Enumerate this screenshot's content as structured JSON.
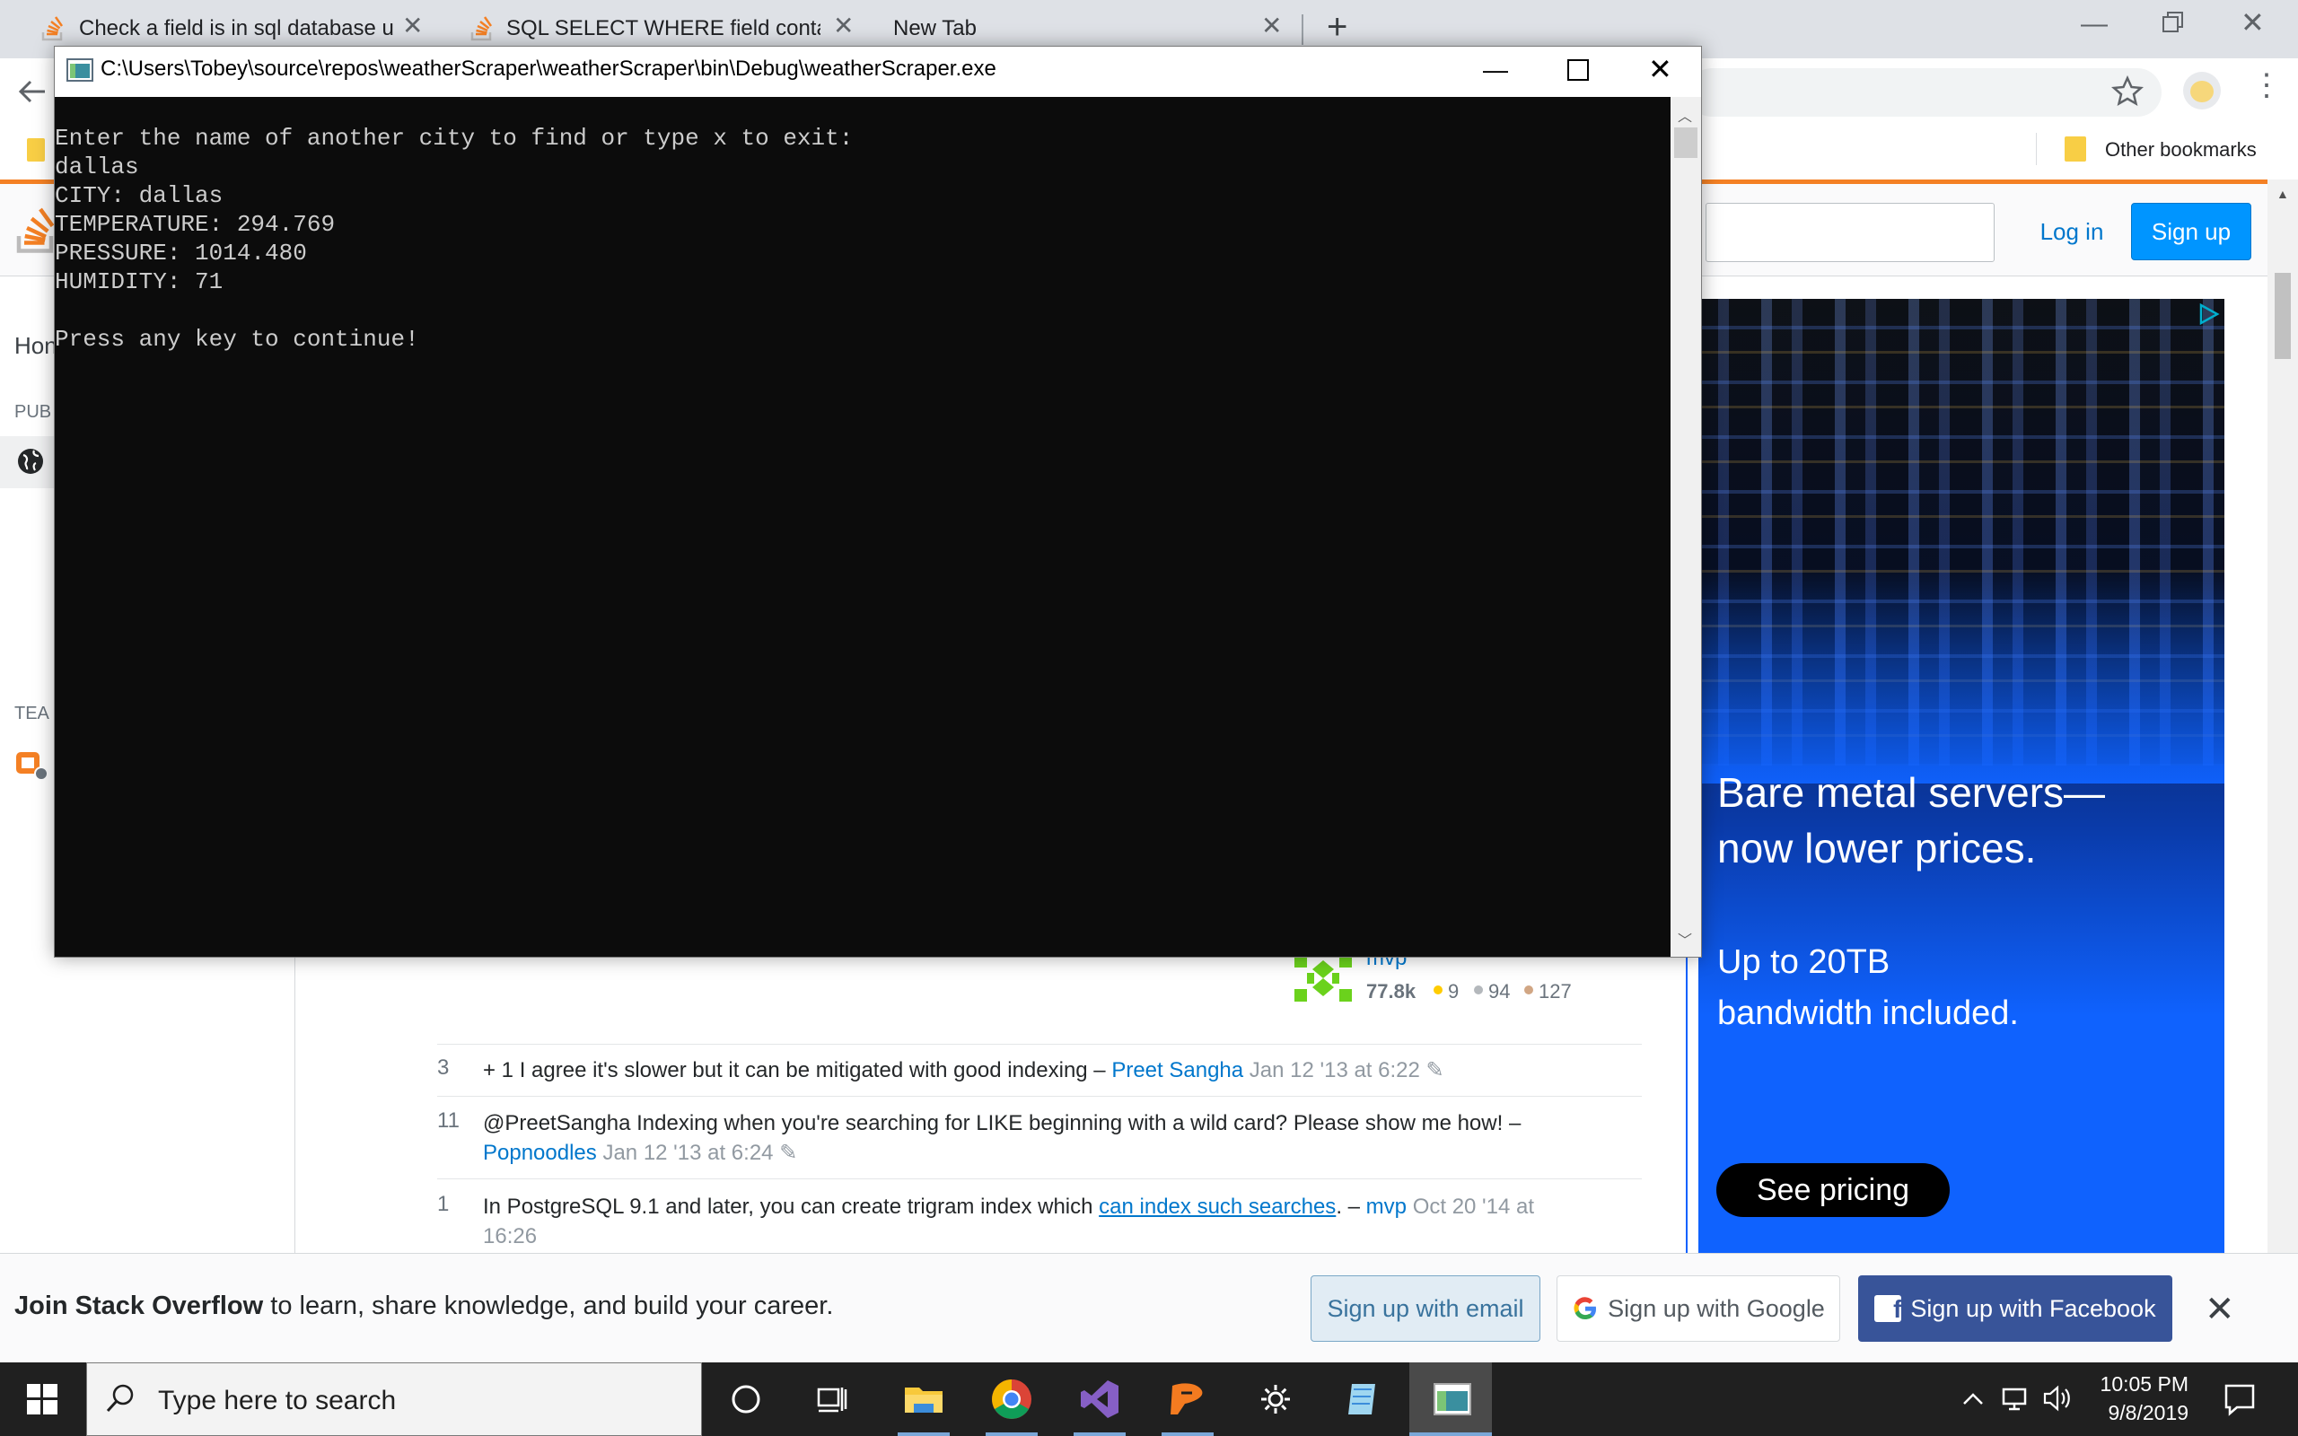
{
  "browser": {
    "tabs": [
      {
        "title": "Check a field is in sql database us"
      },
      {
        "title": "SQL SELECT WHERE field contain"
      },
      {
        "title": "New Tab"
      }
    ],
    "bookmarks": {
      "other": "Other bookmarks"
    }
  },
  "so": {
    "login": "Log in",
    "signup": "Sign up",
    "nav": {
      "home": "Hon",
      "public": "PUB",
      "teams": "TEA"
    }
  },
  "console": {
    "title": "C:\\Users\\Tobey\\source\\repos\\weatherScraper\\weatherScraper\\bin\\Debug\\weatherScraper.exe",
    "lines": "Enter the name of another city to find or type x to exit:\ndallas\nCITY: dallas\nTEMPERATURE: 294.769\nPRESSURE: 1014.480\nHUMIDITY: 71\n\nPress any key to continue!"
  },
  "user_card": {
    "name": "mvp",
    "reputation": "77.8k",
    "gold": "9",
    "silver": "94",
    "bronze": "127"
  },
  "comments": [
    {
      "score": "3",
      "text": "+ 1 I agree it's slower but it can be mitigated with good indexing –",
      "user": "Preet Sangha",
      "date": "Jan 12 '13 at 6:22"
    },
    {
      "score": "11",
      "text": "@PreetSangha Indexing when you're searching for LIKE beginning with a wild card? Please show me how! –",
      "user": "Popnoodles",
      "date": "Jan 12 '13 at 6:24"
    },
    {
      "score": "1",
      "text_before": "In PostgreSQL 9.1 and later, you can create trigram index which",
      "link": "can index such searches",
      "text_after": ". –",
      "user": "mvp",
      "date_line1": "Oct 20 '14 at",
      "date_line2": "16:26"
    }
  ],
  "ad": {
    "headline1": "Bare metal servers—",
    "headline2": "now lower prices.",
    "sub1": "Up to 20TB",
    "sub2": "bandwidth included.",
    "cta": "See pricing"
  },
  "banner": {
    "bold": "Join Stack Overflow",
    "rest": " to learn, share knowledge, and build your career.",
    "email": "Sign up with email",
    "google": "Sign up with Google",
    "facebook": "Sign up with Facebook"
  },
  "taskbar": {
    "search_placeholder": "Type here to search",
    "time": "10:05 PM",
    "date": "9/8/2019"
  },
  "colors": {
    "so_orange": "#f48024",
    "so_blue": "#0095ff",
    "ibm_blue": "#0f62fe",
    "facebook": "#385499",
    "console_bg": "#0c0c0c"
  }
}
